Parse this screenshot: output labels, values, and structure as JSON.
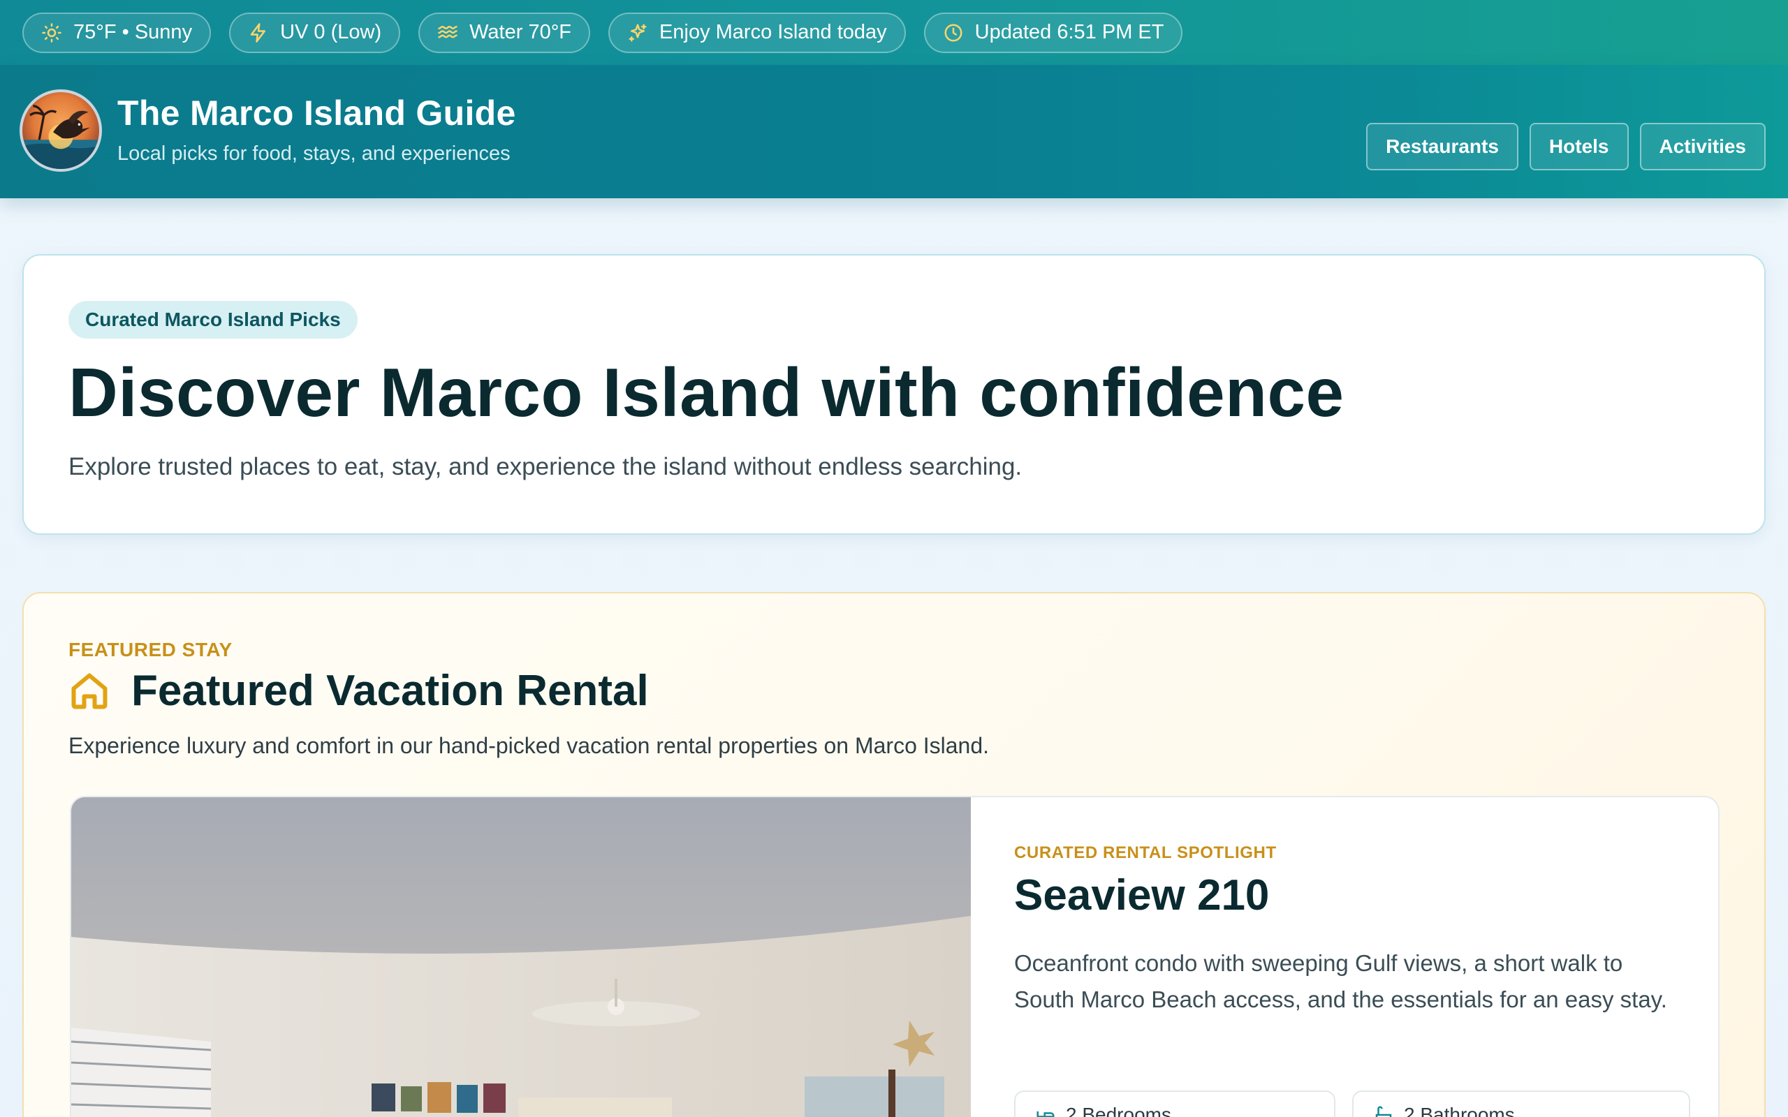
{
  "topbar": {
    "pills": [
      {
        "icon": "sun-icon",
        "label": "75°F • Sunny"
      },
      {
        "icon": "bolt-icon",
        "label": "UV 0 (Low)"
      },
      {
        "icon": "waves-icon",
        "label": "Water 70°F"
      },
      {
        "icon": "sparkles-icon",
        "label": "Enjoy Marco Island today"
      },
      {
        "icon": "clock-icon",
        "label": "Updated 6:51 PM ET"
      }
    ]
  },
  "header": {
    "title": "The Marco Island Guide",
    "tagline": "Local picks for food, stays, and experiences",
    "nav": [
      "Restaurants",
      "Hotels",
      "Activities"
    ]
  },
  "hero": {
    "badge": "Curated Marco Island Picks",
    "title": "Discover Marco Island with confidence",
    "subtitle": "Explore trusted places to eat, stay, and experience the island without endless searching."
  },
  "featured": {
    "eyebrow": "FEATURED STAY",
    "title": "Featured Vacation Rental",
    "description": "Experience luxury and comfort in our hand-picked vacation rental properties on Marco Island.",
    "rental": {
      "label": "CURATED RENTAL SPOTLIGHT",
      "name": "Seaview 210",
      "description": "Oceanfront condo with sweeping Gulf views, a short walk to South Marco Beach access, and the essentials for an easy stay.",
      "bedrooms": "2 Bedrooms",
      "bathrooms": "2 Bathrooms"
    }
  },
  "colors": {
    "accent_teal": "#0b7f92",
    "accent_gold": "#c8901a",
    "title_dark": "#0a2a30"
  }
}
